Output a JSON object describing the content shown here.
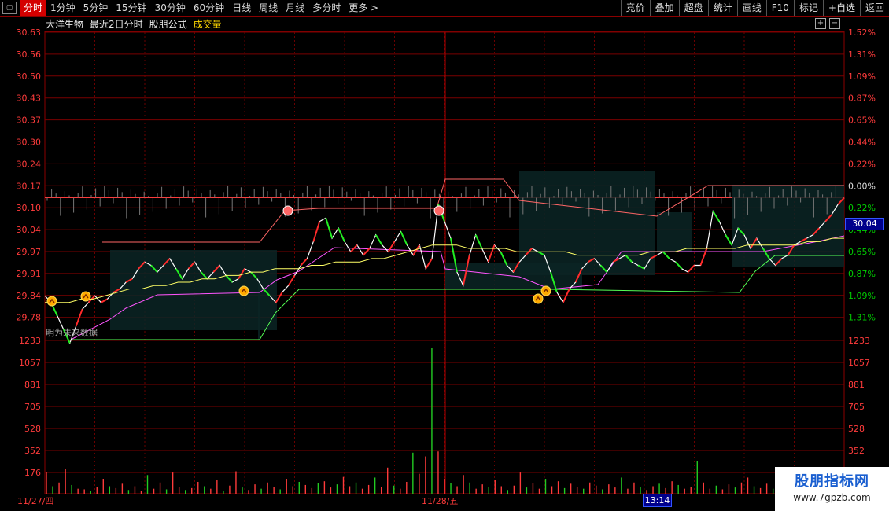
{
  "toolbar": {
    "tabs": [
      {
        "label": "分时",
        "active": true
      },
      {
        "label": "1分钟"
      },
      {
        "label": "5分钟"
      },
      {
        "label": "15分钟"
      },
      {
        "label": "30分钟"
      },
      {
        "label": "60分钟"
      },
      {
        "label": "日线"
      },
      {
        "label": "周线"
      },
      {
        "label": "月线"
      },
      {
        "label": "多分时"
      },
      {
        "label": "更多 >"
      }
    ],
    "buttons": [
      "竞价",
      "叠加",
      "超盘",
      "统计",
      "画线",
      "F10",
      "标记",
      "+自选",
      "返回"
    ]
  },
  "title": {
    "stock_name": "大洋生物",
    "range": "最近2日分时",
    "formula": "股朋公式",
    "volume_label": "成交量"
  },
  "notice": "明为未来数据",
  "price_tag": "30.04",
  "time_tag": "13:14",
  "logo": {
    "main": "股朋指标网",
    "sub": "www.7gpzb.com"
  },
  "chart_data": {
    "type": "line",
    "price_axis": [
      "30.63",
      "30.56",
      "30.50",
      "30.43",
      "30.37",
      "30.30",
      "30.24",
      "30.17",
      "30.10",
      "30.04",
      "29.97",
      "29.91",
      "29.84",
      "29.78"
    ],
    "pct_axis": [
      "1.52%",
      "1.31%",
      "1.09%",
      "0.87%",
      "0.65%",
      "0.44%",
      "0.22%",
      "0.00%",
      "0.22%",
      "0.44%",
      "0.65%",
      "0.87%",
      "1.09%",
      "1.31%"
    ],
    "volume_axis": [
      "1233",
      "1057",
      "881",
      "705",
      "528",
      "352",
      "176"
    ],
    "date_labels": [
      "11/27/四",
      "11/28/五"
    ],
    "ylim": [
      29.75,
      30.66
    ],
    "prev_close": 30.17,
    "volume_max": 1233,
    "price_series": [
      29.88,
      29.86,
      29.82,
      29.78,
      29.74,
      29.79,
      29.84,
      29.86,
      29.88,
      29.86,
      29.87,
      29.89,
      29.9,
      29.92,
      29.93,
      29.96,
      29.98,
      29.97,
      29.95,
      29.97,
      29.99,
      29.96,
      29.93,
      29.96,
      29.98,
      29.95,
      29.93,
      29.95,
      29.97,
      29.94,
      29.92,
      29.93,
      29.96,
      29.95,
      29.93,
      29.9,
      29.88,
      29.86,
      29.89,
      29.91,
      29.94,
      29.97,
      29.99,
      30.04,
      30.1,
      30.11,
      30.05,
      30.08,
      30.04,
      30.01,
      30.03,
      30.0,
      30.02,
      30.06,
      30.03,
      30.01,
      30.04,
      30.07,
      30.03,
      30.0,
      30.03,
      29.96,
      29.99,
      30.15,
      30.1,
      30.05,
      29.95,
      29.91,
      30.0,
      30.06,
      30.02,
      29.98,
      30.03,
      30.01,
      29.97,
      29.95,
      29.98,
      30.0,
      30.02,
      30.01,
      30.0,
      29.95,
      29.89,
      29.86,
      29.9,
      29.92,
      29.96,
      29.98,
      29.99,
      29.97,
      29.95,
      29.98,
      29.99,
      30.0,
      29.98,
      29.97,
      29.96,
      29.99,
      30.0,
      30.01,
      29.99,
      29.98,
      29.96,
      29.95,
      29.97,
      29.97,
      30.02,
      30.13,
      30.1,
      30.06,
      30.03,
      30.08,
      30.06,
      30.02,
      30.05,
      30.02,
      29.99,
      29.97,
      29.99,
      30.0,
      30.03,
      30.04,
      30.05,
      30.06,
      30.08,
      30.1,
      30.12,
      30.15,
      30.17
    ],
    "avg_series": [
      29.86,
      29.86,
      29.86,
      29.87,
      29.87,
      29.88,
      29.89,
      29.9,
      29.9,
      29.91,
      29.91,
      29.92,
      29.92,
      29.93,
      29.93,
      29.94,
      29.94,
      29.95,
      29.95,
      29.96,
      29.96,
      29.96,
      29.97,
      29.97,
      29.98,
      29.98,
      29.98,
      29.99,
      29.99,
      30.0,
      30.01,
      30.02,
      30.03,
      30.03,
      30.03,
      30.02,
      30.02,
      30.02,
      30.02,
      30.01,
      30.01,
      30.01,
      30.01,
      30.01,
      30.0,
      30.0,
      30.0,
      30.0,
      30.0,
      30.0,
      30.01,
      30.01,
      30.01,
      30.02,
      30.02,
      30.02,
      30.02,
      30.02,
      30.03,
      30.03,
      30.03,
      30.03,
      30.03,
      30.04,
      30.04,
      30.05,
      30.05
    ],
    "volume_series": [
      175,
      60,
      90,
      200,
      70,
      40,
      35,
      25,
      55,
      120,
      60,
      45,
      80,
      30,
      60,
      25,
      150,
      40,
      90,
      35,
      170,
      55,
      30,
      45,
      95,
      60,
      40,
      110,
      25,
      65,
      180,
      50,
      30,
      75,
      40,
      90,
      55,
      35,
      120,
      60,
      95,
      70,
      45,
      85,
      100,
      50,
      75,
      135,
      60,
      90,
      40,
      70,
      130,
      55,
      210,
      65,
      40,
      95,
      330,
      160,
      300,
      1170,
      340,
      120,
      85,
      60,
      150,
      90,
      40,
      75,
      55,
      110,
      60,
      30,
      65,
      170,
      50,
      85,
      40,
      120,
      60,
      100,
      45,
      80,
      55,
      40,
      90,
      65,
      35,
      75,
      50,
      130,
      40,
      90,
      55,
      30,
      60,
      80,
      45,
      100,
      70,
      40,
      55,
      260,
      90,
      40,
      65,
      35,
      75,
      50,
      90,
      130,
      60,
      45,
      80,
      40,
      95,
      60,
      35,
      70,
      50,
      40,
      65,
      45,
      30,
      60,
      55
    ]
  }
}
